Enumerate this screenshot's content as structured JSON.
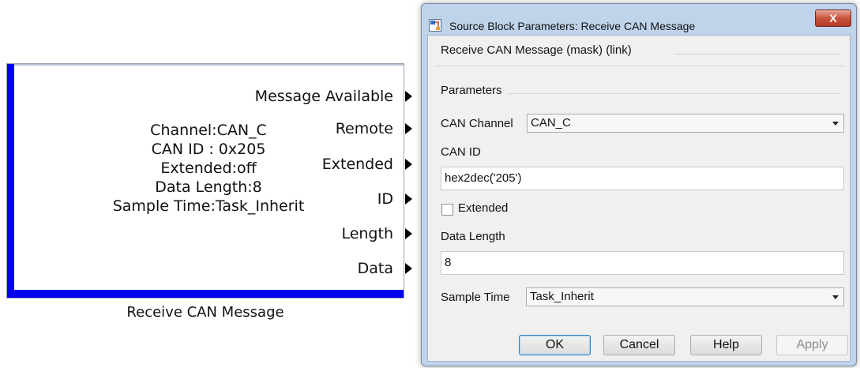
{
  "block": {
    "info_lines": [
      "Channel:CAN_C",
      "CAN ID : 0x205",
      "Extended:off",
      "Data Length:8",
      "Sample Time:Task_Inherit"
    ],
    "ports": [
      "Message Available",
      "Remote",
      "Extended",
      "ID",
      "Length",
      "Data"
    ],
    "caption": "Receive CAN Message"
  },
  "dialog": {
    "title": "Source Block Parameters: Receive CAN Message",
    "close_label": "X",
    "description": "Receive CAN Message (mask) (link)",
    "parameters_title": "Parameters",
    "can_channel": {
      "label": "CAN Channel",
      "value": "CAN_C"
    },
    "can_id": {
      "label": "CAN ID",
      "value": "hex2dec('205')"
    },
    "extended": {
      "label": "Extended",
      "checked": false
    },
    "data_length": {
      "label": "Data Length",
      "value": "8"
    },
    "sample_time": {
      "label": "Sample Time",
      "value": "Task_Inherit"
    },
    "buttons": {
      "ok": "OK",
      "cancel": "Cancel",
      "help": "Help",
      "apply": "Apply"
    }
  },
  "colors": {
    "block_edge": "#0000ee",
    "dialog_frame": "#bfd3ea",
    "close_button": "#c8553f"
  }
}
